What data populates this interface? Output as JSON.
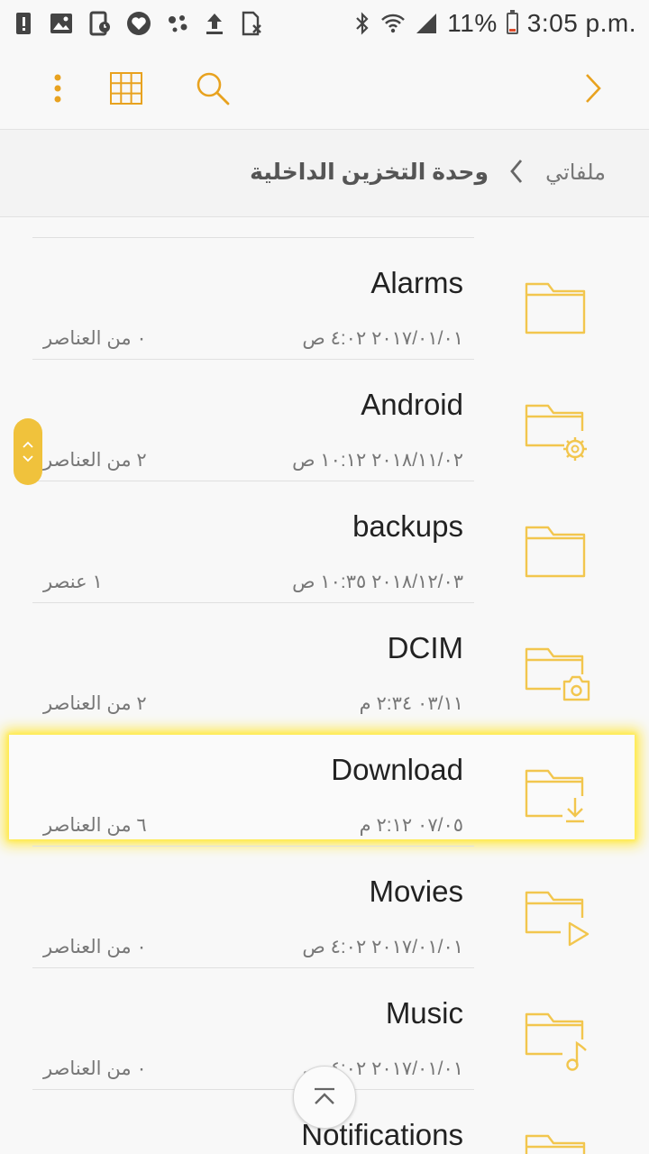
{
  "status_bar": {
    "battery": "11%",
    "time": "3:05 p.m.",
    "icons": [
      "alert-icon",
      "image-icon",
      "tablet-alarm-icon",
      "heart-shield-icon",
      "assistant-dots-icon",
      "upload-icon",
      "sim-off-icon",
      "bluetooth-icon",
      "wifi-icon",
      "signal-icon",
      "battery-icon"
    ]
  },
  "app_bar": {
    "icons": [
      "more-vert-icon",
      "grid-view-icon",
      "search-icon",
      "chevron-right-icon"
    ],
    "accent": "#e8a21f"
  },
  "breadcrumb": {
    "root": "ملفاتي",
    "current": "وحدة التخزين الداخلية"
  },
  "folders": [
    {
      "name": "Alarms",
      "date": "٢٠١٧/٠١/٠١ ٤:٠٢ ص",
      "count": "٠ من العناصر",
      "icon": "folder-icon"
    },
    {
      "name": "Android",
      "date": "٢٠١٨/١١/٠٢ ١٠:١٢ ص",
      "count": "٢ من العناصر",
      "icon": "folder-settings-icon"
    },
    {
      "name": "backups",
      "date": "٢٠١٨/١٢/٠٣ ١٠:٣٥ ص",
      "count": "١ عنصر",
      "icon": "folder-icon"
    },
    {
      "name": "DCIM",
      "date": "٠٣/١١ ٢:٣٤ م",
      "count": "٢ من العناصر",
      "icon": "folder-camera-icon"
    },
    {
      "name": "Download",
      "date": "٠٧/٠٥ ٢:١٢ م",
      "count": "٦ من العناصر",
      "icon": "folder-download-icon",
      "highlighted": true
    },
    {
      "name": "Movies",
      "date": "٢٠١٧/٠١/٠١ ٤:٠٢ ص",
      "count": "٠ من العناصر",
      "icon": "folder-play-icon"
    },
    {
      "name": "Music",
      "date": "٢٠١٧/٠١/٠١ ٤:٠٢ ص",
      "count": "٠ من العناصر",
      "icon": "folder-music-icon"
    },
    {
      "name": "Notifications",
      "date": "",
      "count": "",
      "icon": "folder-icon"
    }
  ],
  "colors": {
    "folder_outline": "#f2c64e",
    "highlight_glow": "#ffe84a",
    "fast_scroller": "#f0c23c"
  }
}
